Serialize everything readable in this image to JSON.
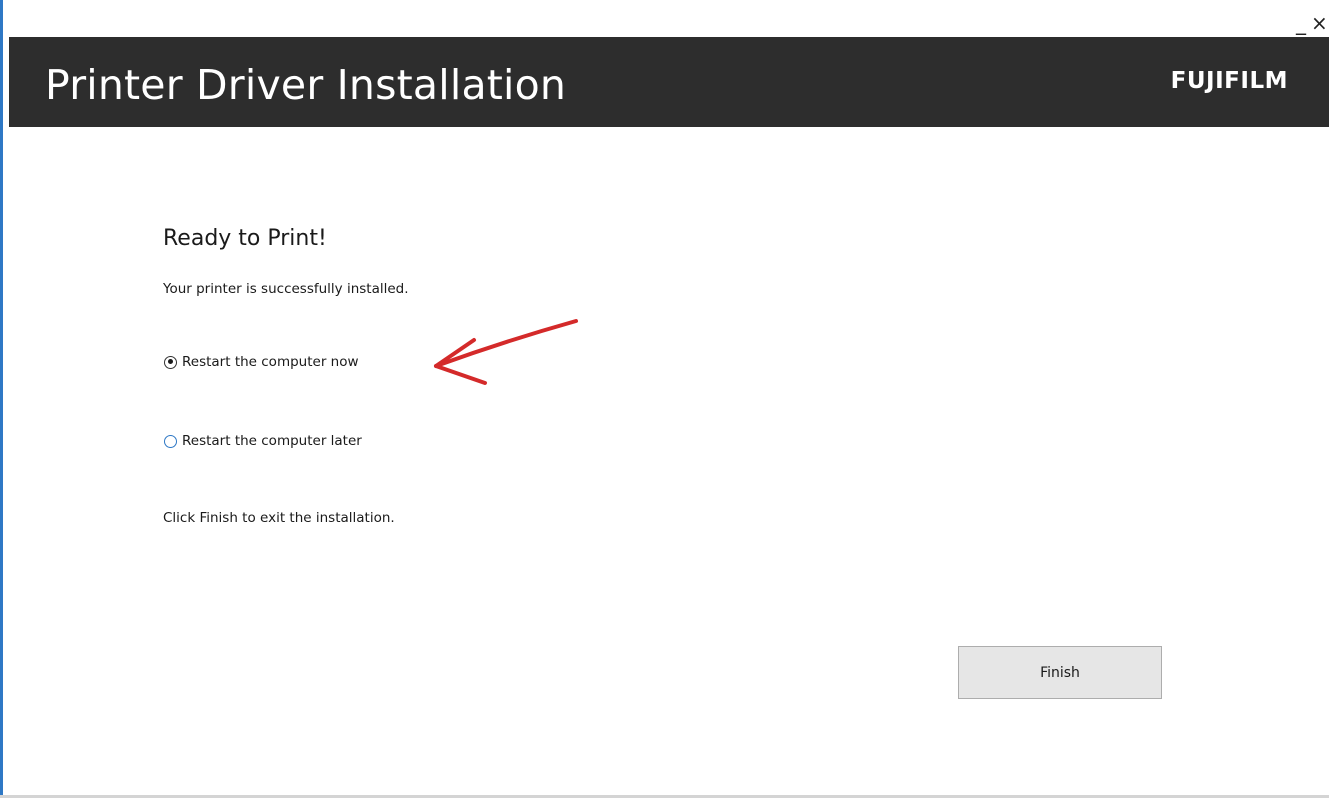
{
  "window": {
    "minimize_glyph": "_",
    "close_glyph": "×"
  },
  "header": {
    "title": "Printer Driver Installation",
    "brand_logo_text": "FUJIFILM",
    "background_color": "#2d2d2d"
  },
  "content": {
    "heading": "Ready to Print!",
    "status_text": "Your printer is successfully installed.",
    "restart_options": [
      {
        "label": "Restart the computer now",
        "selected": true
      },
      {
        "label": "Restart the computer later",
        "selected": false
      }
    ],
    "exit_instruction": "Click Finish to exit the installation."
  },
  "footer": {
    "finish_label": "Finish"
  },
  "annotation": {
    "type": "hand-drawn-arrow",
    "color": "#d42a2a",
    "points_to": "Restart the computer now"
  },
  "colors": {
    "accent": "#2e78c5",
    "header_text": "#ffffff",
    "button_background": "#e6e6e6"
  }
}
